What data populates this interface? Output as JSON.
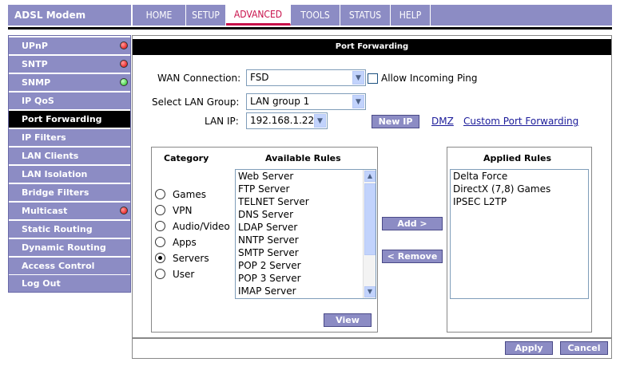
{
  "brand": "ADSL Modem",
  "nav_tabs": [
    {
      "label": "HOME"
    },
    {
      "label": "SETUP"
    },
    {
      "label": "ADVANCED"
    },
    {
      "label": "TOOLS"
    },
    {
      "label": "STATUS"
    },
    {
      "label": "HELP"
    }
  ],
  "active_tab": "ADVANCED",
  "sidebar": {
    "items": [
      {
        "label": "UPnP",
        "status": "red"
      },
      {
        "label": "SNTP",
        "status": "red"
      },
      {
        "label": "SNMP",
        "status": "green"
      },
      {
        "label": "IP QoS"
      },
      {
        "label": "Port Forwarding",
        "active": true
      },
      {
        "label": "IP Filters"
      },
      {
        "label": "LAN Clients"
      },
      {
        "label": "LAN Isolation"
      },
      {
        "label": "Bridge Filters"
      },
      {
        "label": "Multicast",
        "status": "red"
      },
      {
        "label": "Static Routing"
      },
      {
        "label": "Dynamic Routing"
      },
      {
        "label": "Access Control"
      },
      {
        "label": "Log Out"
      }
    ]
  },
  "page_title": "Port Forwarding",
  "form": {
    "wan_connection_label": "WAN Connection:",
    "wan_connection_value": "FSD",
    "allow_ping_label": "Allow Incoming Ping",
    "allow_ping_checked": false,
    "lan_group_label": "Select LAN Group:",
    "lan_group_value": "LAN group 1",
    "lan_ip_label": "LAN IP:",
    "lan_ip_value": "192.168.1.22",
    "new_ip_button": "New IP",
    "dmz_link": "DMZ",
    "custom_pf_link": "Custom Port Forwarding"
  },
  "category": {
    "header": "Category",
    "options": [
      {
        "label": "Games",
        "selected": false
      },
      {
        "label": "VPN",
        "selected": false
      },
      {
        "label": "Audio/Video",
        "selected": false
      },
      {
        "label": "Apps",
        "selected": false
      },
      {
        "label": "Servers",
        "selected": true
      },
      {
        "label": "User",
        "selected": false
      }
    ]
  },
  "available_rules": {
    "header": "Available Rules",
    "items": [
      "Web Server",
      "FTP Server",
      "TELNET Server",
      "DNS Server",
      "LDAP Server",
      "NNTP Server",
      "SMTP Server",
      "POP 2 Server",
      "POP 3 Server",
      "IMAP Server"
    ]
  },
  "view_button": "View",
  "add_button": "Add >",
  "remove_button": "< Remove",
  "applied_rules": {
    "header": "Applied Rules",
    "items": [
      "Delta Force",
      "DirectX (7,8) Games",
      "IPSEC L2TP"
    ]
  },
  "apply_button": "Apply",
  "cancel_button": "Cancel",
  "colors": {
    "nav_bg": "#8c8cc4",
    "active_tab_accent": "#c8104a",
    "status_red": "#e00000",
    "status_green": "#18c018"
  }
}
